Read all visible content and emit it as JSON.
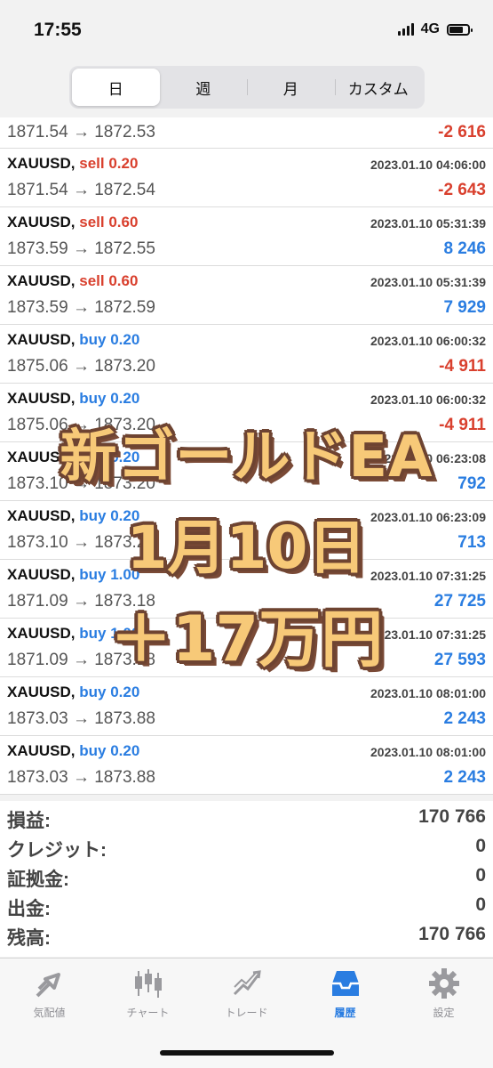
{
  "status": {
    "time": "17:55",
    "network": "4G"
  },
  "tabs": [
    "日",
    "週",
    "月",
    "カスタム"
  ],
  "first_row": {
    "prices": "1871.54 → 1872.53",
    "pnl": "-2 616",
    "pnl_sign": "neg"
  },
  "deals": [
    {
      "symbol": "XAUUSD,",
      "side": "sell 0.20",
      "side_type": "sell",
      "datetime": "2023.01.10 04:06:00",
      "prices": "1871.54 → 1872.54",
      "pnl": "-2 643",
      "pnl_sign": "neg"
    },
    {
      "symbol": "XAUUSD,",
      "side": "sell 0.60",
      "side_type": "sell",
      "datetime": "2023.01.10 05:31:39",
      "prices": "1873.59 → 1872.55",
      "pnl": "8 246",
      "pnl_sign": "pos"
    },
    {
      "symbol": "XAUUSD,",
      "side": "sell 0.60",
      "side_type": "sell",
      "datetime": "2023.01.10 05:31:39",
      "prices": "1873.59 → 1872.59",
      "pnl": "7 929",
      "pnl_sign": "pos"
    },
    {
      "symbol": "XAUUSD,",
      "side": "buy 0.20",
      "side_type": "buy",
      "datetime": "2023.01.10 06:00:32",
      "prices": "1875.06 → 1873.20",
      "pnl": "-4 911",
      "pnl_sign": "neg"
    },
    {
      "symbol": "XAUUSD,",
      "side": "buy 0.20",
      "side_type": "buy",
      "datetime": "2023.01.10 06:00:32",
      "prices": "1875.06 → 1873.20",
      "pnl": "-4 911",
      "pnl_sign": "neg"
    },
    {
      "symbol": "XAUUSD,",
      "side": "buy 0.20",
      "side_type": "buy",
      "datetime": "2023.01.10 06:23:08",
      "prices": "1873.10 → 1873.20",
      "pnl": "792",
      "pnl_sign": "pos"
    },
    {
      "symbol": "XAUUSD,",
      "side": "buy 0.20",
      "side_type": "buy",
      "datetime": "2023.01.10 06:23:09",
      "prices": "1873.10 → 1873.20",
      "pnl": "713",
      "pnl_sign": "pos"
    },
    {
      "symbol": "XAUUSD,",
      "side": "buy 1.00",
      "side_type": "buy",
      "datetime": "2023.01.10 07:31:25",
      "prices": "1871.09 → 1873.18",
      "pnl": "27 725",
      "pnl_sign": "pos"
    },
    {
      "symbol": "XAUUSD,",
      "side": "buy 1.00",
      "side_type": "buy",
      "datetime": "2023.01.10 07:31:25",
      "prices": "1871.09 → 1873.18",
      "pnl": "27 593",
      "pnl_sign": "pos"
    },
    {
      "symbol": "XAUUSD,",
      "side": "buy 0.20",
      "side_type": "buy",
      "datetime": "2023.01.10 08:01:00",
      "prices": "1873.03 → 1873.88",
      "pnl": "2 243",
      "pnl_sign": "pos"
    },
    {
      "symbol": "XAUUSD,",
      "side": "buy 0.20",
      "side_type": "buy",
      "datetime": "2023.01.10 08:01:00",
      "prices": "1873.03 → 1873.88",
      "pnl": "2 243",
      "pnl_sign": "pos"
    }
  ],
  "summary": [
    {
      "label": "損益:",
      "value": "170 766"
    },
    {
      "label": "クレジット:",
      "value": "0"
    },
    {
      "label": "証拠金:",
      "value": "0"
    },
    {
      "label": "出金:",
      "value": "0"
    },
    {
      "label": "残高:",
      "value": "170 766"
    }
  ],
  "tabbar": [
    {
      "label": "気配値",
      "icon": "quotes-arrows-icon",
      "active": false
    },
    {
      "label": "チャート",
      "icon": "candlestick-chart-icon",
      "active": false
    },
    {
      "label": "トレード",
      "icon": "trade-chart-icon",
      "active": false
    },
    {
      "label": "履歴",
      "icon": "history-inbox-icon",
      "active": true
    },
    {
      "label": "設定",
      "icon": "gear-icon",
      "active": false
    }
  ],
  "overlay": {
    "line1": "新ゴールドEA",
    "line2": "1月10日",
    "line3": "＋17万円"
  },
  "colors": {
    "sell": "#d9402e",
    "buy": "#2a7de1",
    "loss": "#d9402e",
    "profit": "#2a7de1",
    "overlay_fill": "#f7c978",
    "overlay_stroke": "#6e4432"
  }
}
